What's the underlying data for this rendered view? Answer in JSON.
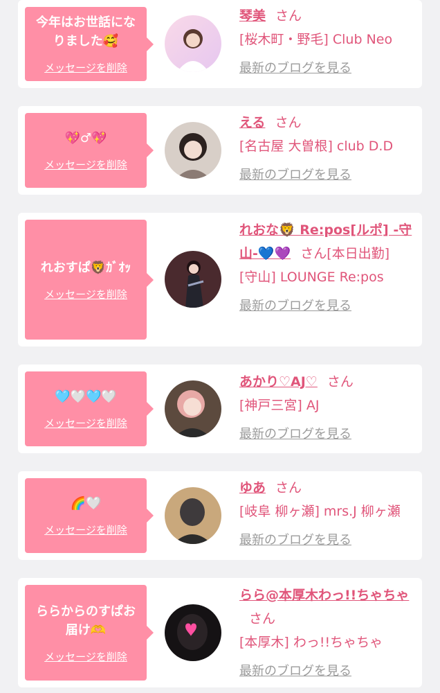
{
  "colors": {
    "accent": "#ff8fa6",
    "name": "#e0557a",
    "link_gray": "#9b9b9b",
    "background": "#f1f1f3"
  },
  "delete_label": "メッセージを削除",
  "blog_label": "最新のブログを見る",
  "san_label": "さん",
  "cards": [
    {
      "message": "今年はお世話になりました🥰",
      "name": "琴美",
      "shop": "[桜木町・野毛] Club Neo",
      "avatar_icon": "girl-photo"
    },
    {
      "message": "💖♂︎💖",
      "name": "える",
      "shop": "[名古屋 大曽根] club D.D",
      "avatar_icon": "girl-photo"
    },
    {
      "message": "れおすぱ🦁ｶﾞｵｯ",
      "name": "れおな🦁 Re:pos[ルポ] -守山-💙💜",
      "extra": "[本日出勤]",
      "shop": "[守山] LOUNGE Re:pos",
      "avatar_icon": "girl-photo"
    },
    {
      "message": "🩵🤍🩵🤍",
      "name": "あかり♡AJ♡",
      "shop": "[神戸三宮] AJ",
      "avatar_icon": "girl-photo"
    },
    {
      "message": "🌈🤍",
      "name": "ゆあ",
      "shop": "[岐阜 柳ヶ瀬] mrs.J 柳ヶ瀬",
      "avatar_icon": "girl-photo"
    },
    {
      "message": "ららからのすぱお届け🫶",
      "name": "らら@本厚木わっ!!ちゃちゃ",
      "shop": "[本厚木] わっ!!ちゃちゃ",
      "avatar_icon": "girl-photo"
    }
  ]
}
